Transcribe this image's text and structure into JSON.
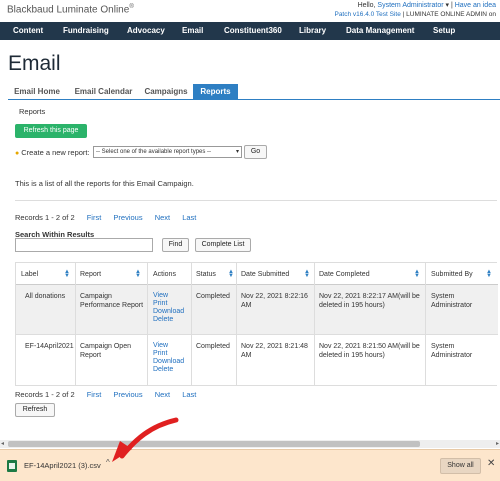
{
  "header": {
    "brand": "Blackbaud Luminate Online",
    "greeting": "Hello,",
    "user": "System Administrator",
    "idea_link": "Have an idea",
    "patch": "Patch v16.4.0 Test Site",
    "site": "LUMINATE ONLINE ADMIN on"
  },
  "nav": {
    "items": [
      "Content",
      "Fundraising",
      "Advocacy",
      "Email",
      "Constituent360",
      "Library",
      "Data Management",
      "Setup"
    ]
  },
  "page": {
    "title": "Email",
    "subtabs": [
      "Email Home",
      "Email Calendar",
      "Campaigns",
      "Reports"
    ],
    "active_subtab": "Reports",
    "breadcrumb": "Reports",
    "refresh_page_label": "Refresh this page",
    "create_label": "Create a new report:",
    "select_value": "-- Select one of the available report types --",
    "go_label": "Go",
    "intro": "This is a list of all the reports for this Email Campaign."
  },
  "pager": {
    "records": "Records 1 - 2 of 2",
    "first": "First",
    "previous": "Previous",
    "next": "Next",
    "last": "Last"
  },
  "search": {
    "label": "Search Within Results",
    "find_label": "Find",
    "complete_list_label": "Complete List",
    "value": ""
  },
  "table": {
    "headers": [
      "Label",
      "Report",
      "Actions",
      "Status",
      "Date Submitted",
      "Date Completed",
      "Submitted By"
    ],
    "rows": [
      {
        "label": "All donations",
        "report": "Campaign Performance Report",
        "actions": [
          "View",
          "Print",
          "Download",
          "Delete"
        ],
        "status": "Completed",
        "submitted": "Nov 22, 2021 8:22:16 AM",
        "completed": "Nov 22, 2021 8:22:17 AM(will be deleted in 195 hours)",
        "by": "System Administrator"
      },
      {
        "label": "EF-14April2021",
        "report": "Campaign Open Report",
        "actions": [
          "View",
          "Print",
          "Download",
          "Delete"
        ],
        "status": "Completed",
        "submitted": "Nov 22, 2021 8:21:48 AM",
        "completed": "Nov 22, 2021 8:21:50 AM(will be deleted in 195 hours)",
        "by": "System Administrator"
      }
    ]
  },
  "refresh_label": "Refresh",
  "download_bar": {
    "filename": "EF-14April2021 (3).csv",
    "show_all_label": "Show all",
    "file_icon": "excel-file-icon",
    "accent": "#fde6cc"
  },
  "colors": {
    "nav_bg": "#22374b",
    "accent_blue": "#2e7fc3",
    "green_button": "#2bb36a",
    "annotation_arrow": "#e02020"
  }
}
